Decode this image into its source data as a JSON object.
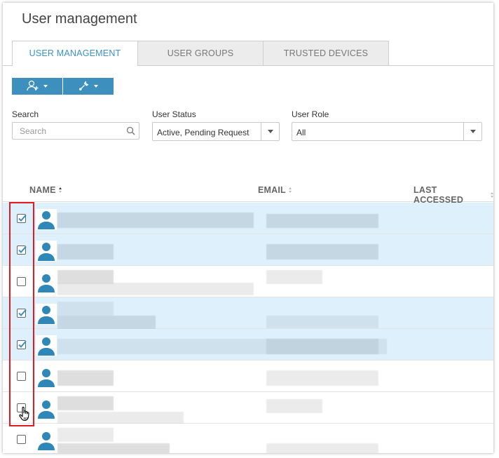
{
  "page": {
    "title": "User management"
  },
  "tabs": [
    {
      "label": "USER MANAGEMENT",
      "active": true
    },
    {
      "label": "USER GROUPS",
      "active": false
    },
    {
      "label": "TRUSTED DEVICES",
      "active": false
    }
  ],
  "toolbar": {
    "add_user_icon": "add-user-icon",
    "tools_icon": "wrench-icon",
    "accent": "#3d8fbe"
  },
  "filters": {
    "search": {
      "label": "Search",
      "placeholder": "Search",
      "value": ""
    },
    "status": {
      "label": "User Status",
      "value": "Active, Pending Request"
    },
    "role": {
      "label": "User Role",
      "value": "All"
    }
  },
  "table": {
    "columns": [
      {
        "label": "NAME",
        "sort": "asc"
      },
      {
        "label": "EMAIL",
        "sort": "none"
      },
      {
        "label": "LAST ACCESSED",
        "sort": "none"
      }
    ],
    "rows": [
      {
        "checked": true
      },
      {
        "checked": true
      },
      {
        "checked": false
      },
      {
        "checked": true
      },
      {
        "checked": true
      },
      {
        "checked": false
      },
      {
        "checked": false
      },
      {
        "checked": false
      }
    ]
  },
  "colors": {
    "selected_row": "#ddf0fb",
    "tab_active_text": "#3a92c4",
    "check": "#3d8fbe",
    "highlight_border": "#e11b22",
    "avatar": "#2f87b8"
  }
}
